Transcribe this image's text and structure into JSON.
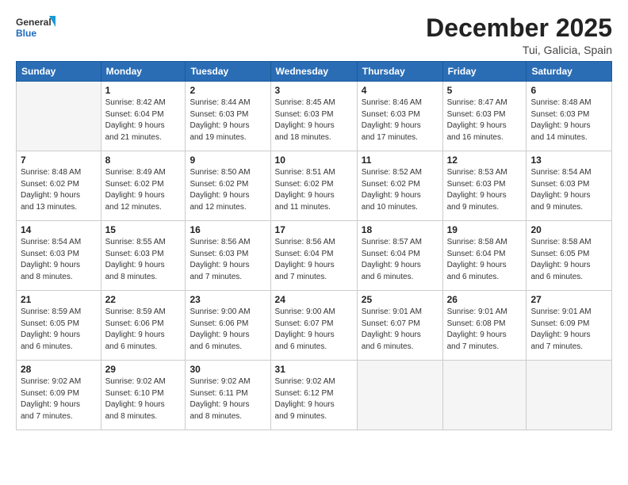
{
  "logo": {
    "line1": "General",
    "line2": "Blue"
  },
  "title": "December 2025",
  "location": "Tui, Galicia, Spain",
  "days_header": [
    "Sunday",
    "Monday",
    "Tuesday",
    "Wednesday",
    "Thursday",
    "Friday",
    "Saturday"
  ],
  "weeks": [
    [
      {
        "day": "",
        "info": ""
      },
      {
        "day": "1",
        "info": "Sunrise: 8:42 AM\nSunset: 6:04 PM\nDaylight: 9 hours\nand 21 minutes."
      },
      {
        "day": "2",
        "info": "Sunrise: 8:44 AM\nSunset: 6:03 PM\nDaylight: 9 hours\nand 19 minutes."
      },
      {
        "day": "3",
        "info": "Sunrise: 8:45 AM\nSunset: 6:03 PM\nDaylight: 9 hours\nand 18 minutes."
      },
      {
        "day": "4",
        "info": "Sunrise: 8:46 AM\nSunset: 6:03 PM\nDaylight: 9 hours\nand 17 minutes."
      },
      {
        "day": "5",
        "info": "Sunrise: 8:47 AM\nSunset: 6:03 PM\nDaylight: 9 hours\nand 16 minutes."
      },
      {
        "day": "6",
        "info": "Sunrise: 8:48 AM\nSunset: 6:03 PM\nDaylight: 9 hours\nand 14 minutes."
      }
    ],
    [
      {
        "day": "7",
        "info": "Sunrise: 8:48 AM\nSunset: 6:02 PM\nDaylight: 9 hours\nand 13 minutes."
      },
      {
        "day": "8",
        "info": "Sunrise: 8:49 AM\nSunset: 6:02 PM\nDaylight: 9 hours\nand 12 minutes."
      },
      {
        "day": "9",
        "info": "Sunrise: 8:50 AM\nSunset: 6:02 PM\nDaylight: 9 hours\nand 12 minutes."
      },
      {
        "day": "10",
        "info": "Sunrise: 8:51 AM\nSunset: 6:02 PM\nDaylight: 9 hours\nand 11 minutes."
      },
      {
        "day": "11",
        "info": "Sunrise: 8:52 AM\nSunset: 6:02 PM\nDaylight: 9 hours\nand 10 minutes."
      },
      {
        "day": "12",
        "info": "Sunrise: 8:53 AM\nSunset: 6:03 PM\nDaylight: 9 hours\nand 9 minutes."
      },
      {
        "day": "13",
        "info": "Sunrise: 8:54 AM\nSunset: 6:03 PM\nDaylight: 9 hours\nand 9 minutes."
      }
    ],
    [
      {
        "day": "14",
        "info": "Sunrise: 8:54 AM\nSunset: 6:03 PM\nDaylight: 9 hours\nand 8 minutes."
      },
      {
        "day": "15",
        "info": "Sunrise: 8:55 AM\nSunset: 6:03 PM\nDaylight: 9 hours\nand 8 minutes."
      },
      {
        "day": "16",
        "info": "Sunrise: 8:56 AM\nSunset: 6:03 PM\nDaylight: 9 hours\nand 7 minutes."
      },
      {
        "day": "17",
        "info": "Sunrise: 8:56 AM\nSunset: 6:04 PM\nDaylight: 9 hours\nand 7 minutes."
      },
      {
        "day": "18",
        "info": "Sunrise: 8:57 AM\nSunset: 6:04 PM\nDaylight: 9 hours\nand 6 minutes."
      },
      {
        "day": "19",
        "info": "Sunrise: 8:58 AM\nSunset: 6:04 PM\nDaylight: 9 hours\nand 6 minutes."
      },
      {
        "day": "20",
        "info": "Sunrise: 8:58 AM\nSunset: 6:05 PM\nDaylight: 9 hours\nand 6 minutes."
      }
    ],
    [
      {
        "day": "21",
        "info": "Sunrise: 8:59 AM\nSunset: 6:05 PM\nDaylight: 9 hours\nand 6 minutes."
      },
      {
        "day": "22",
        "info": "Sunrise: 8:59 AM\nSunset: 6:06 PM\nDaylight: 9 hours\nand 6 minutes."
      },
      {
        "day": "23",
        "info": "Sunrise: 9:00 AM\nSunset: 6:06 PM\nDaylight: 9 hours\nand 6 minutes."
      },
      {
        "day": "24",
        "info": "Sunrise: 9:00 AM\nSunset: 6:07 PM\nDaylight: 9 hours\nand 6 minutes."
      },
      {
        "day": "25",
        "info": "Sunrise: 9:01 AM\nSunset: 6:07 PM\nDaylight: 9 hours\nand 6 minutes."
      },
      {
        "day": "26",
        "info": "Sunrise: 9:01 AM\nSunset: 6:08 PM\nDaylight: 9 hours\nand 7 minutes."
      },
      {
        "day": "27",
        "info": "Sunrise: 9:01 AM\nSunset: 6:09 PM\nDaylight: 9 hours\nand 7 minutes."
      }
    ],
    [
      {
        "day": "28",
        "info": "Sunrise: 9:02 AM\nSunset: 6:09 PM\nDaylight: 9 hours\nand 7 minutes."
      },
      {
        "day": "29",
        "info": "Sunrise: 9:02 AM\nSunset: 6:10 PM\nDaylight: 9 hours\nand 8 minutes."
      },
      {
        "day": "30",
        "info": "Sunrise: 9:02 AM\nSunset: 6:11 PM\nDaylight: 9 hours\nand 8 minutes."
      },
      {
        "day": "31",
        "info": "Sunrise: 9:02 AM\nSunset: 6:12 PM\nDaylight: 9 hours\nand 9 minutes."
      },
      {
        "day": "",
        "info": ""
      },
      {
        "day": "",
        "info": ""
      },
      {
        "day": "",
        "info": ""
      }
    ]
  ]
}
